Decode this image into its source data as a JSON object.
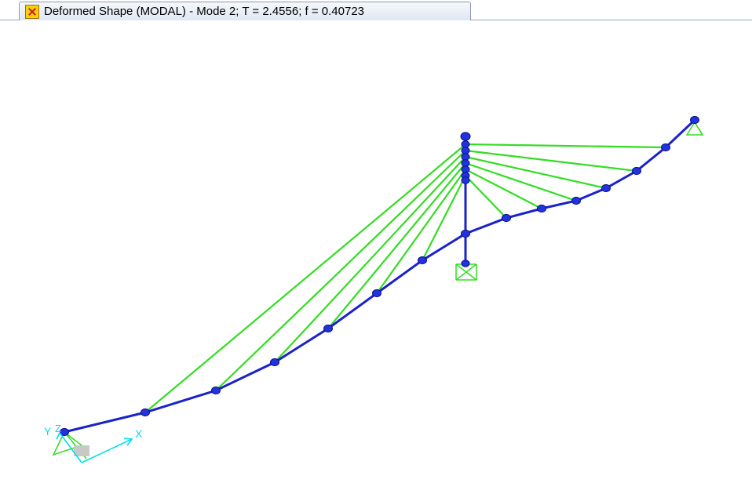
{
  "window": {
    "tab_title": "Deformed Shape (MODAL) - Mode 2; T = 2.4556;  f = 0.40723",
    "tab_icon": "sap2000-app-icon"
  },
  "axes": {
    "x_label": "X",
    "y_label": "Y",
    "z_label": "Z"
  },
  "colors": {
    "deck": "#1a22c8",
    "joint": "#2233dd",
    "cable": "#33dd22",
    "support": "#33dd22",
    "axis": "#00e0f0"
  },
  "model": {
    "deck_joint_count": 15,
    "pylon_joint_count": 9,
    "cable_count": 11,
    "support_count": 3
  }
}
